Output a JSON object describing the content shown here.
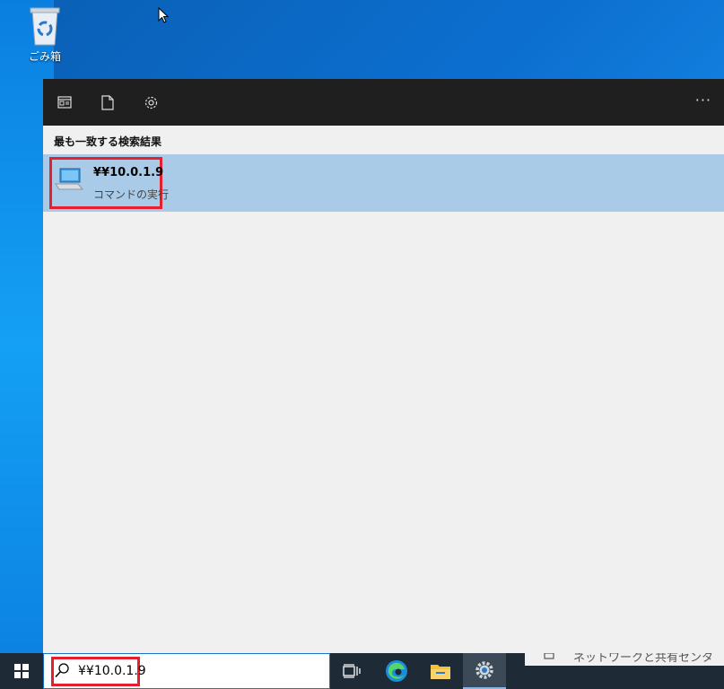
{
  "desktop": {
    "recycle_bin_label": "ごみ箱"
  },
  "search_panel": {
    "toolbar": {
      "icons": [
        "app-icon",
        "document-icon",
        "gear-icon"
      ],
      "more_label": "···"
    },
    "best_match_heading": "最も一致する検索結果",
    "best_match": {
      "title": "¥¥10.0.1.9",
      "subtitle": "コマンドの実行",
      "icon": "computer-icon"
    }
  },
  "taskbar": {
    "search_value": "¥¥10.0.1.9",
    "items": [
      "task-view-icon",
      "edge-icon",
      "file-explorer-icon",
      "settings-icon"
    ],
    "network_hint": "ネットワークと共有センター"
  },
  "colors": {
    "highlight": "#e51f2d",
    "selected_result": "#a9cbe8",
    "taskbar": "#1e2a36"
  }
}
